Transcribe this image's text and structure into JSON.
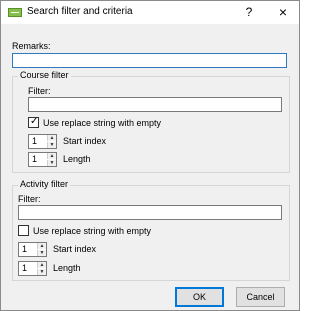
{
  "window": {
    "title": "Search filter and criteria",
    "help_glyph": "?",
    "close_glyph": "×"
  },
  "remarks": {
    "label": "Remarks:",
    "value": ""
  },
  "course_filter": {
    "title": "Course filter",
    "filter_label": "Filter:",
    "filter_value": "",
    "replace_checkbox": {
      "label": "Use replace string with empty",
      "checked": true
    },
    "start_index": {
      "label": "Start index",
      "value": "1"
    },
    "length": {
      "label": "Length",
      "value": "1"
    }
  },
  "activity_filter": {
    "title": "Activity filter",
    "filter_label": "Filter:",
    "filter_value": "",
    "replace_checkbox": {
      "label": "Use replace string with empty",
      "checked": false
    },
    "start_index": {
      "label": "Start index",
      "value": "1"
    },
    "length": {
      "label": "Length",
      "value": "1"
    }
  },
  "buttons": {
    "ok": "OK",
    "cancel": "Cancel"
  },
  "icons": {
    "spin_up": "▲",
    "spin_down": "▼",
    "check": "✓"
  }
}
